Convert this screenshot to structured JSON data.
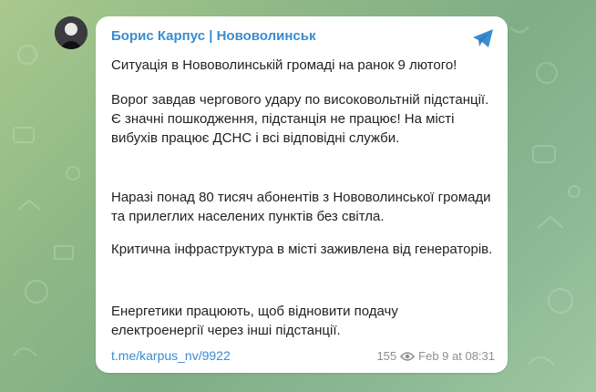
{
  "post": {
    "channel_name": "Борис Карпус | Нововолинськ",
    "paragraphs": [
      "Ситуація в Нововолинській громаді на ранок 9 лютого!",
      "Ворог завдав чергового удару по високовольтній підстанції. Є значні пошкодження, підстанція не працює! На місті вибухів працює ДСНС і всі відповідні служби.",
      "Наразі понад 80 тисяч абонентів з Нововолинської громади та прилеглих населених пунктів без світла.",
      "Критична інфраструктура в місті заживлена від генераторів.",
      "Енергетики працюють, щоб відновити подачу електроенергії через інші підстанції."
    ],
    "link": "t.me/karpus_nv/9922",
    "views": "155",
    "date": "Feb 9 at 08:31"
  },
  "icons": {
    "share": "telegram-share-icon",
    "views": "eye-icon"
  },
  "colors": {
    "accent": "#3a8ccf",
    "text": "#222222",
    "meta": "#8a8f94"
  }
}
